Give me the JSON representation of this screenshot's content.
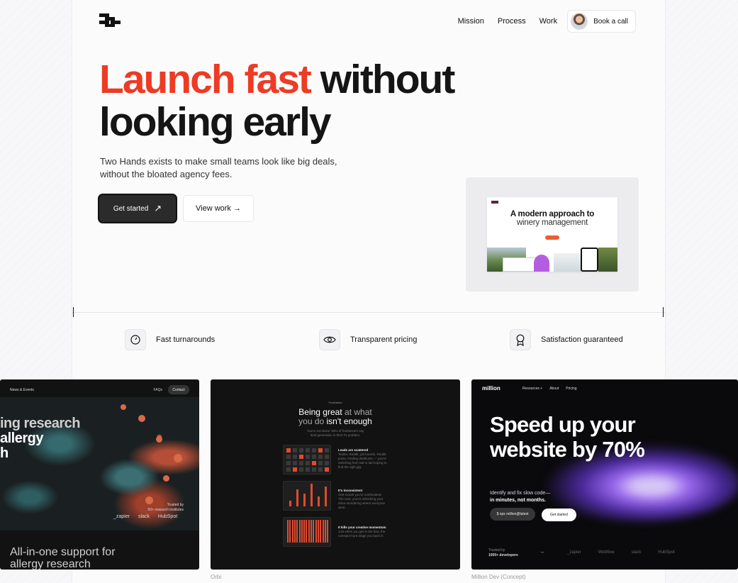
{
  "header": {
    "nav": [
      "Mission",
      "Process",
      "Work"
    ],
    "cta_label": "Book a call"
  },
  "hero": {
    "accent": "Launch fast",
    "title_rest_1": "without",
    "title_line_2": "looking early",
    "subtitle": "Two Hands exists to make small teams look like big deals, without the bloated agency fees."
  },
  "buttons": {
    "primary": "Get started",
    "primary_icon": "↗",
    "secondary": "View work →"
  },
  "preview": {
    "title": "A modern approach to",
    "subtitle": "winery management"
  },
  "features": [
    {
      "label": "Fast turnarounds",
      "icon": "speed-icon"
    },
    {
      "label": "Transparent pricing",
      "icon": "eye-icon"
    },
    {
      "label": "Satisfaction guaranteed",
      "icon": "badge-icon"
    }
  ],
  "cards": {
    "card1": {
      "nav": "News & Events",
      "faq": "FAQs",
      "contact": "Contact",
      "heading_1": "ing research",
      "heading_2": "allergy",
      "heading_3": "h",
      "trusted": "Trusted by",
      "trusted_2": "50+ research institutes",
      "logo_1": "_zapier",
      "logo_2": "slack",
      "logo_3": "HubSpot",
      "footer_1": "All-in-one support for",
      "footer_2": "allergy research"
    },
    "card2": {
      "eyebrow": "Frustration",
      "title_1": "Being great",
      "title_2": "at what",
      "title_3": "you do",
      "title_4": "isn't enough",
      "small_1": "You're not alone: 66% of freelancers say",
      "small_2": "lead generation is their #1 problem.",
      "p1_title": "Leads are scattered",
      "p1_text": "Twitter, Reddit, job boards, Reddit posts, Finding dealhunts — you're switching from tab to tab hoping to find the right gig.",
      "p2_title": "It's inconsistent",
      "p2_text": "One month you're overbooked. The next, you're refreshing your inbox wondering where everyone went.",
      "p3_title": "It kills your creative momentum",
      "p3_text": "Just when you get in the flow, the constant hunt drags you back in.",
      "caption": "Orbi"
    },
    "card3": {
      "brand": "million",
      "menu": [
        "Resources +",
        "About",
        "Pricing"
      ],
      "headline_1": "Speed up your",
      "headline_2": "website by 70%",
      "desc_1": "Identify and fix slow code—",
      "desc_2": "in minutes, not months.",
      "npx": "$ npx million@latest",
      "cta": "Get started",
      "trusted_1": "Trusted by",
      "trusted_2": "1000+ developers",
      "logos": [
        "_zapier",
        "Webflow",
        "slack",
        "HubSpot"
      ],
      "caption": "Million Dev (Concept)"
    }
  }
}
